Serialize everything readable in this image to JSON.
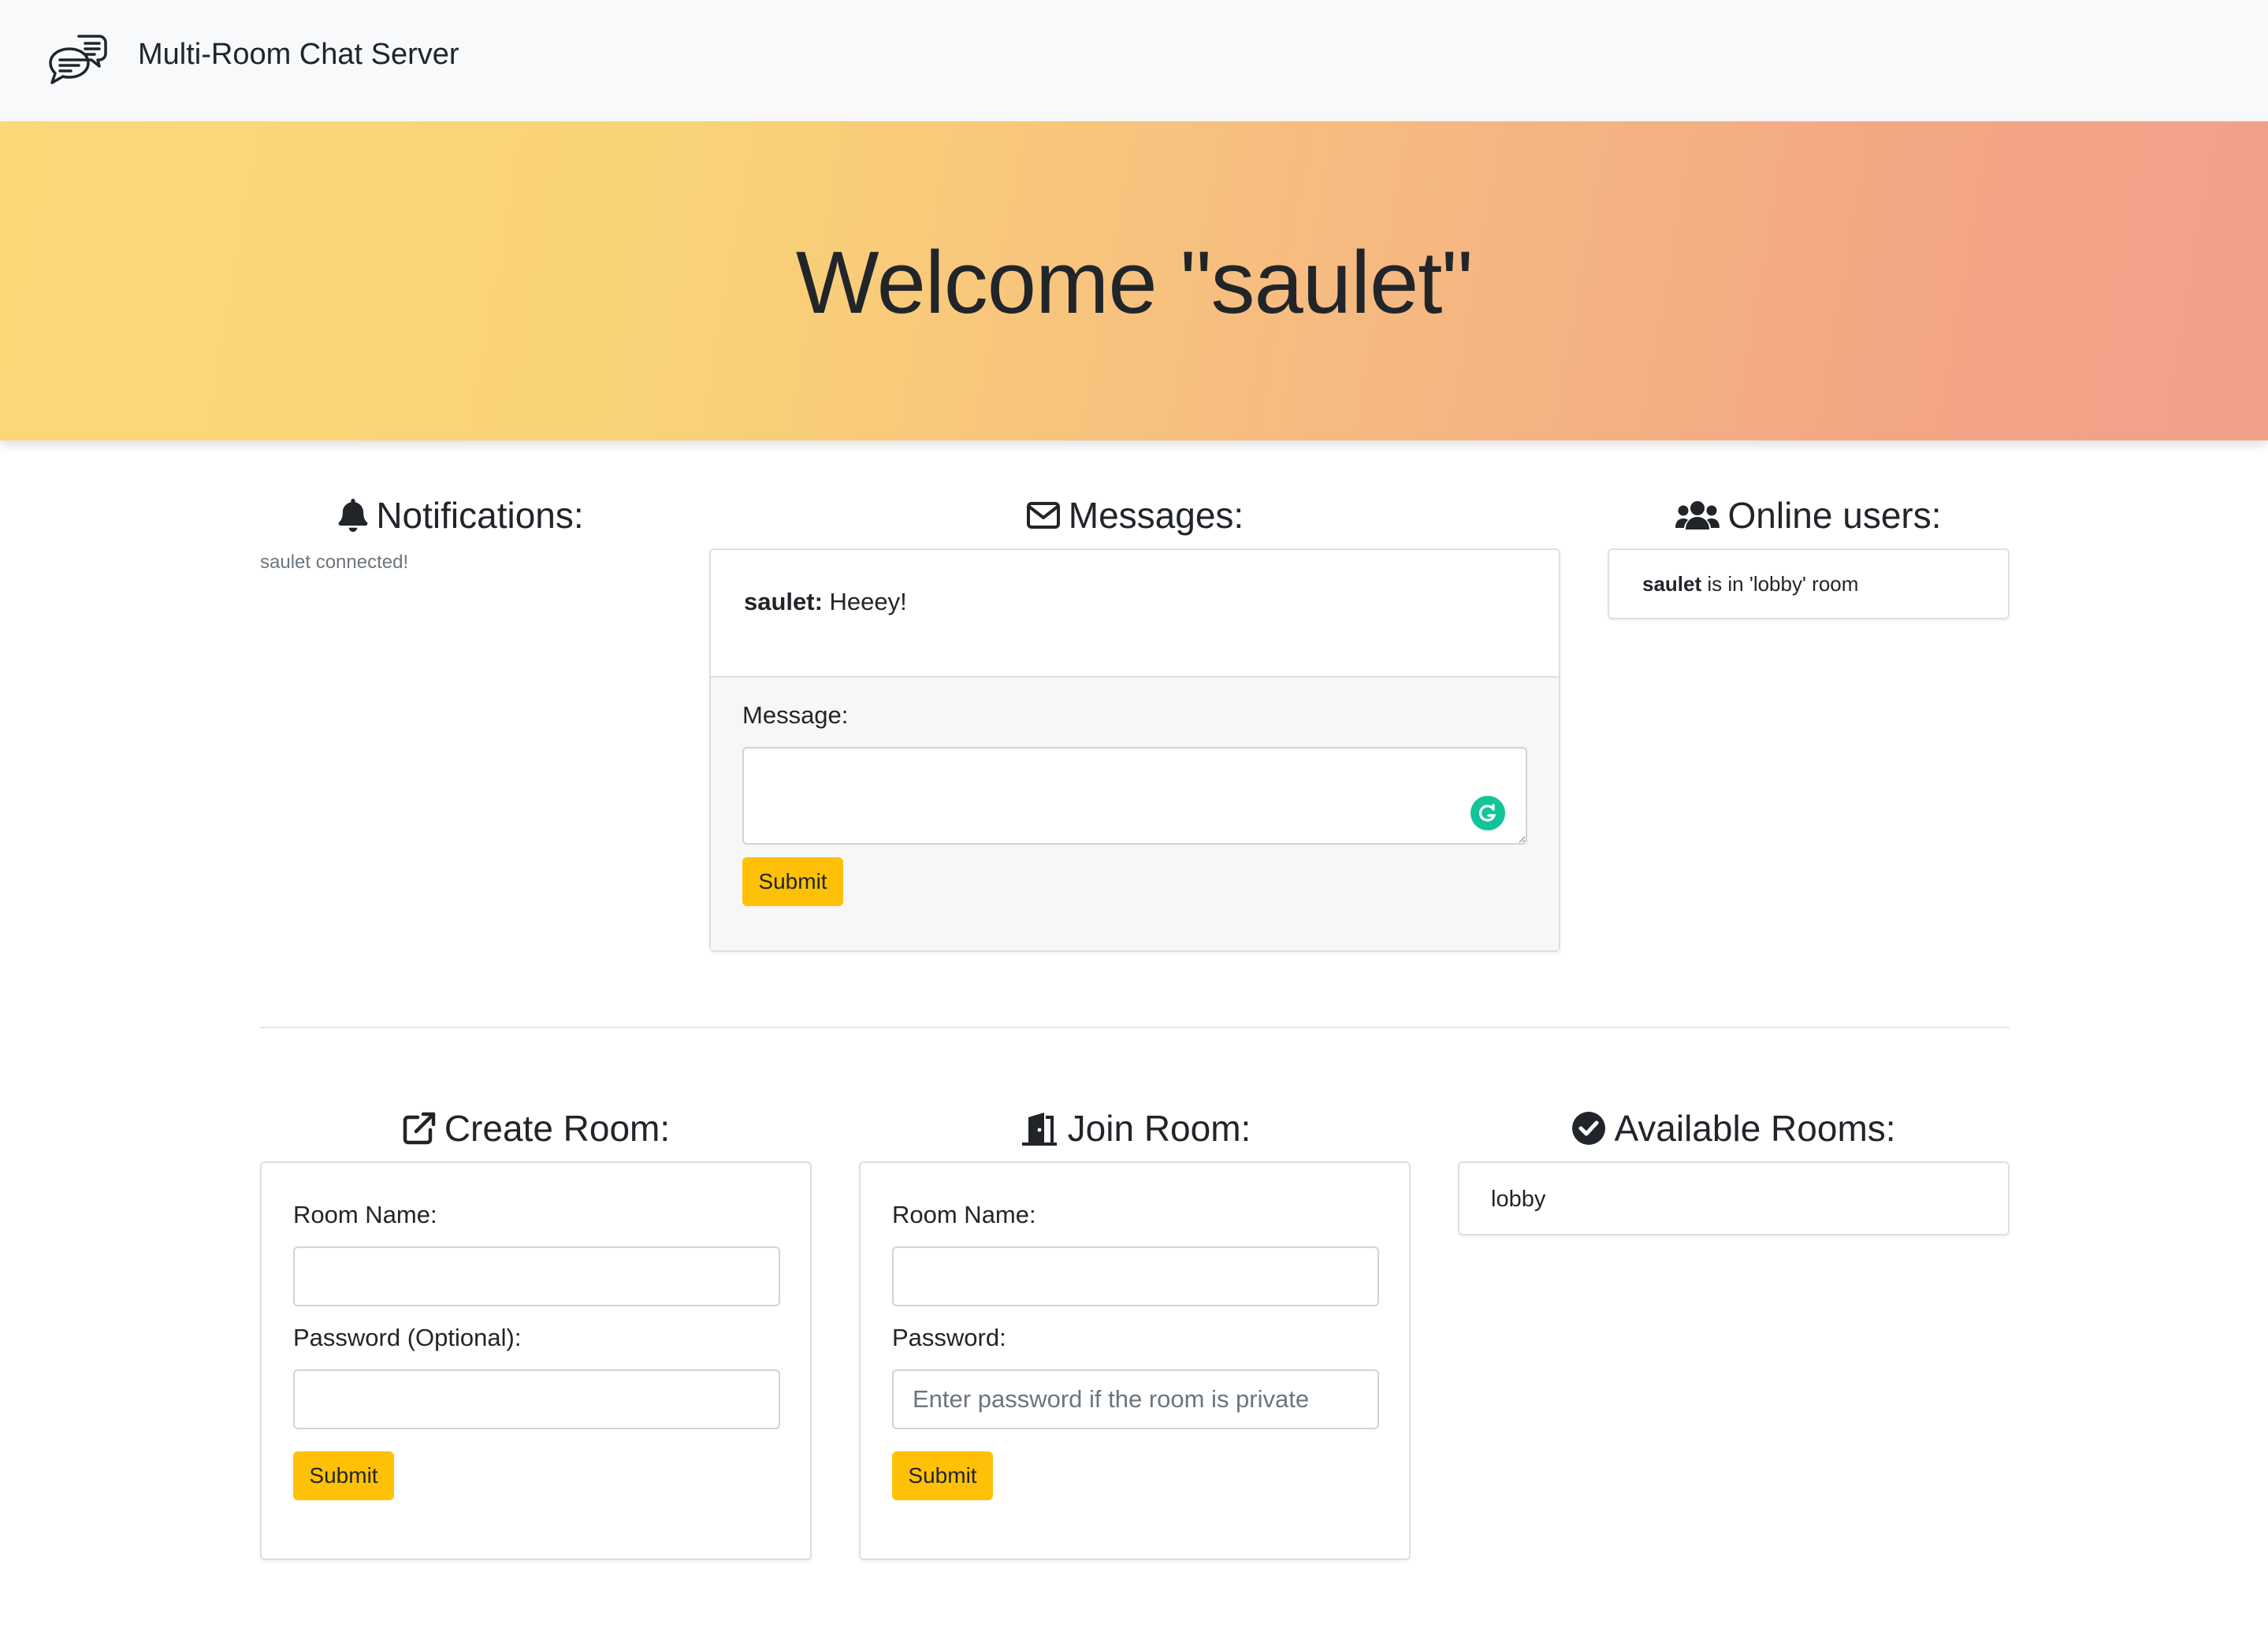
{
  "navbar": {
    "brand": "Multi-Room Chat Server",
    "icon": "chat-bubbles-icon"
  },
  "hero": {
    "title": "Welcome \"saulet\""
  },
  "notifications": {
    "heading": "Notifications:",
    "icon": "bell-icon",
    "items": [
      "saulet connected!"
    ]
  },
  "messages": {
    "heading": "Messages:",
    "icon": "envelope-icon",
    "items": [
      {
        "user": "saulet:",
        "text": "Heeey!"
      }
    ],
    "form": {
      "label": "Message:",
      "value": "",
      "submit_label": "Submit"
    }
  },
  "online_users": {
    "heading": "Online users:",
    "icon": "users-icon",
    "items": [
      {
        "user": "saulet",
        "text": "is in 'lobby' room"
      }
    ]
  },
  "create_room": {
    "heading": "Create Room:",
    "icon": "external-link-icon",
    "room_name_label": "Room Name:",
    "room_name_value": "",
    "password_label": "Password (Optional):",
    "password_value": "",
    "submit_label": "Submit"
  },
  "join_room": {
    "heading": "Join Room:",
    "icon": "door-open-icon",
    "room_name_label": "Room Name:",
    "room_name_value": "",
    "password_label": "Password:",
    "password_placeholder": "Enter password if the room is private",
    "submit_label": "Submit"
  },
  "available_rooms": {
    "heading": "Available Rooms:",
    "icon": "check-circle-icon",
    "items": [
      "lobby"
    ]
  },
  "colors": {
    "accent_button": "#ffc107",
    "hero_gradient_start": "#fbd977",
    "hero_gradient_end": "#f2a08a",
    "grammarly_badge": "#15c39a"
  }
}
